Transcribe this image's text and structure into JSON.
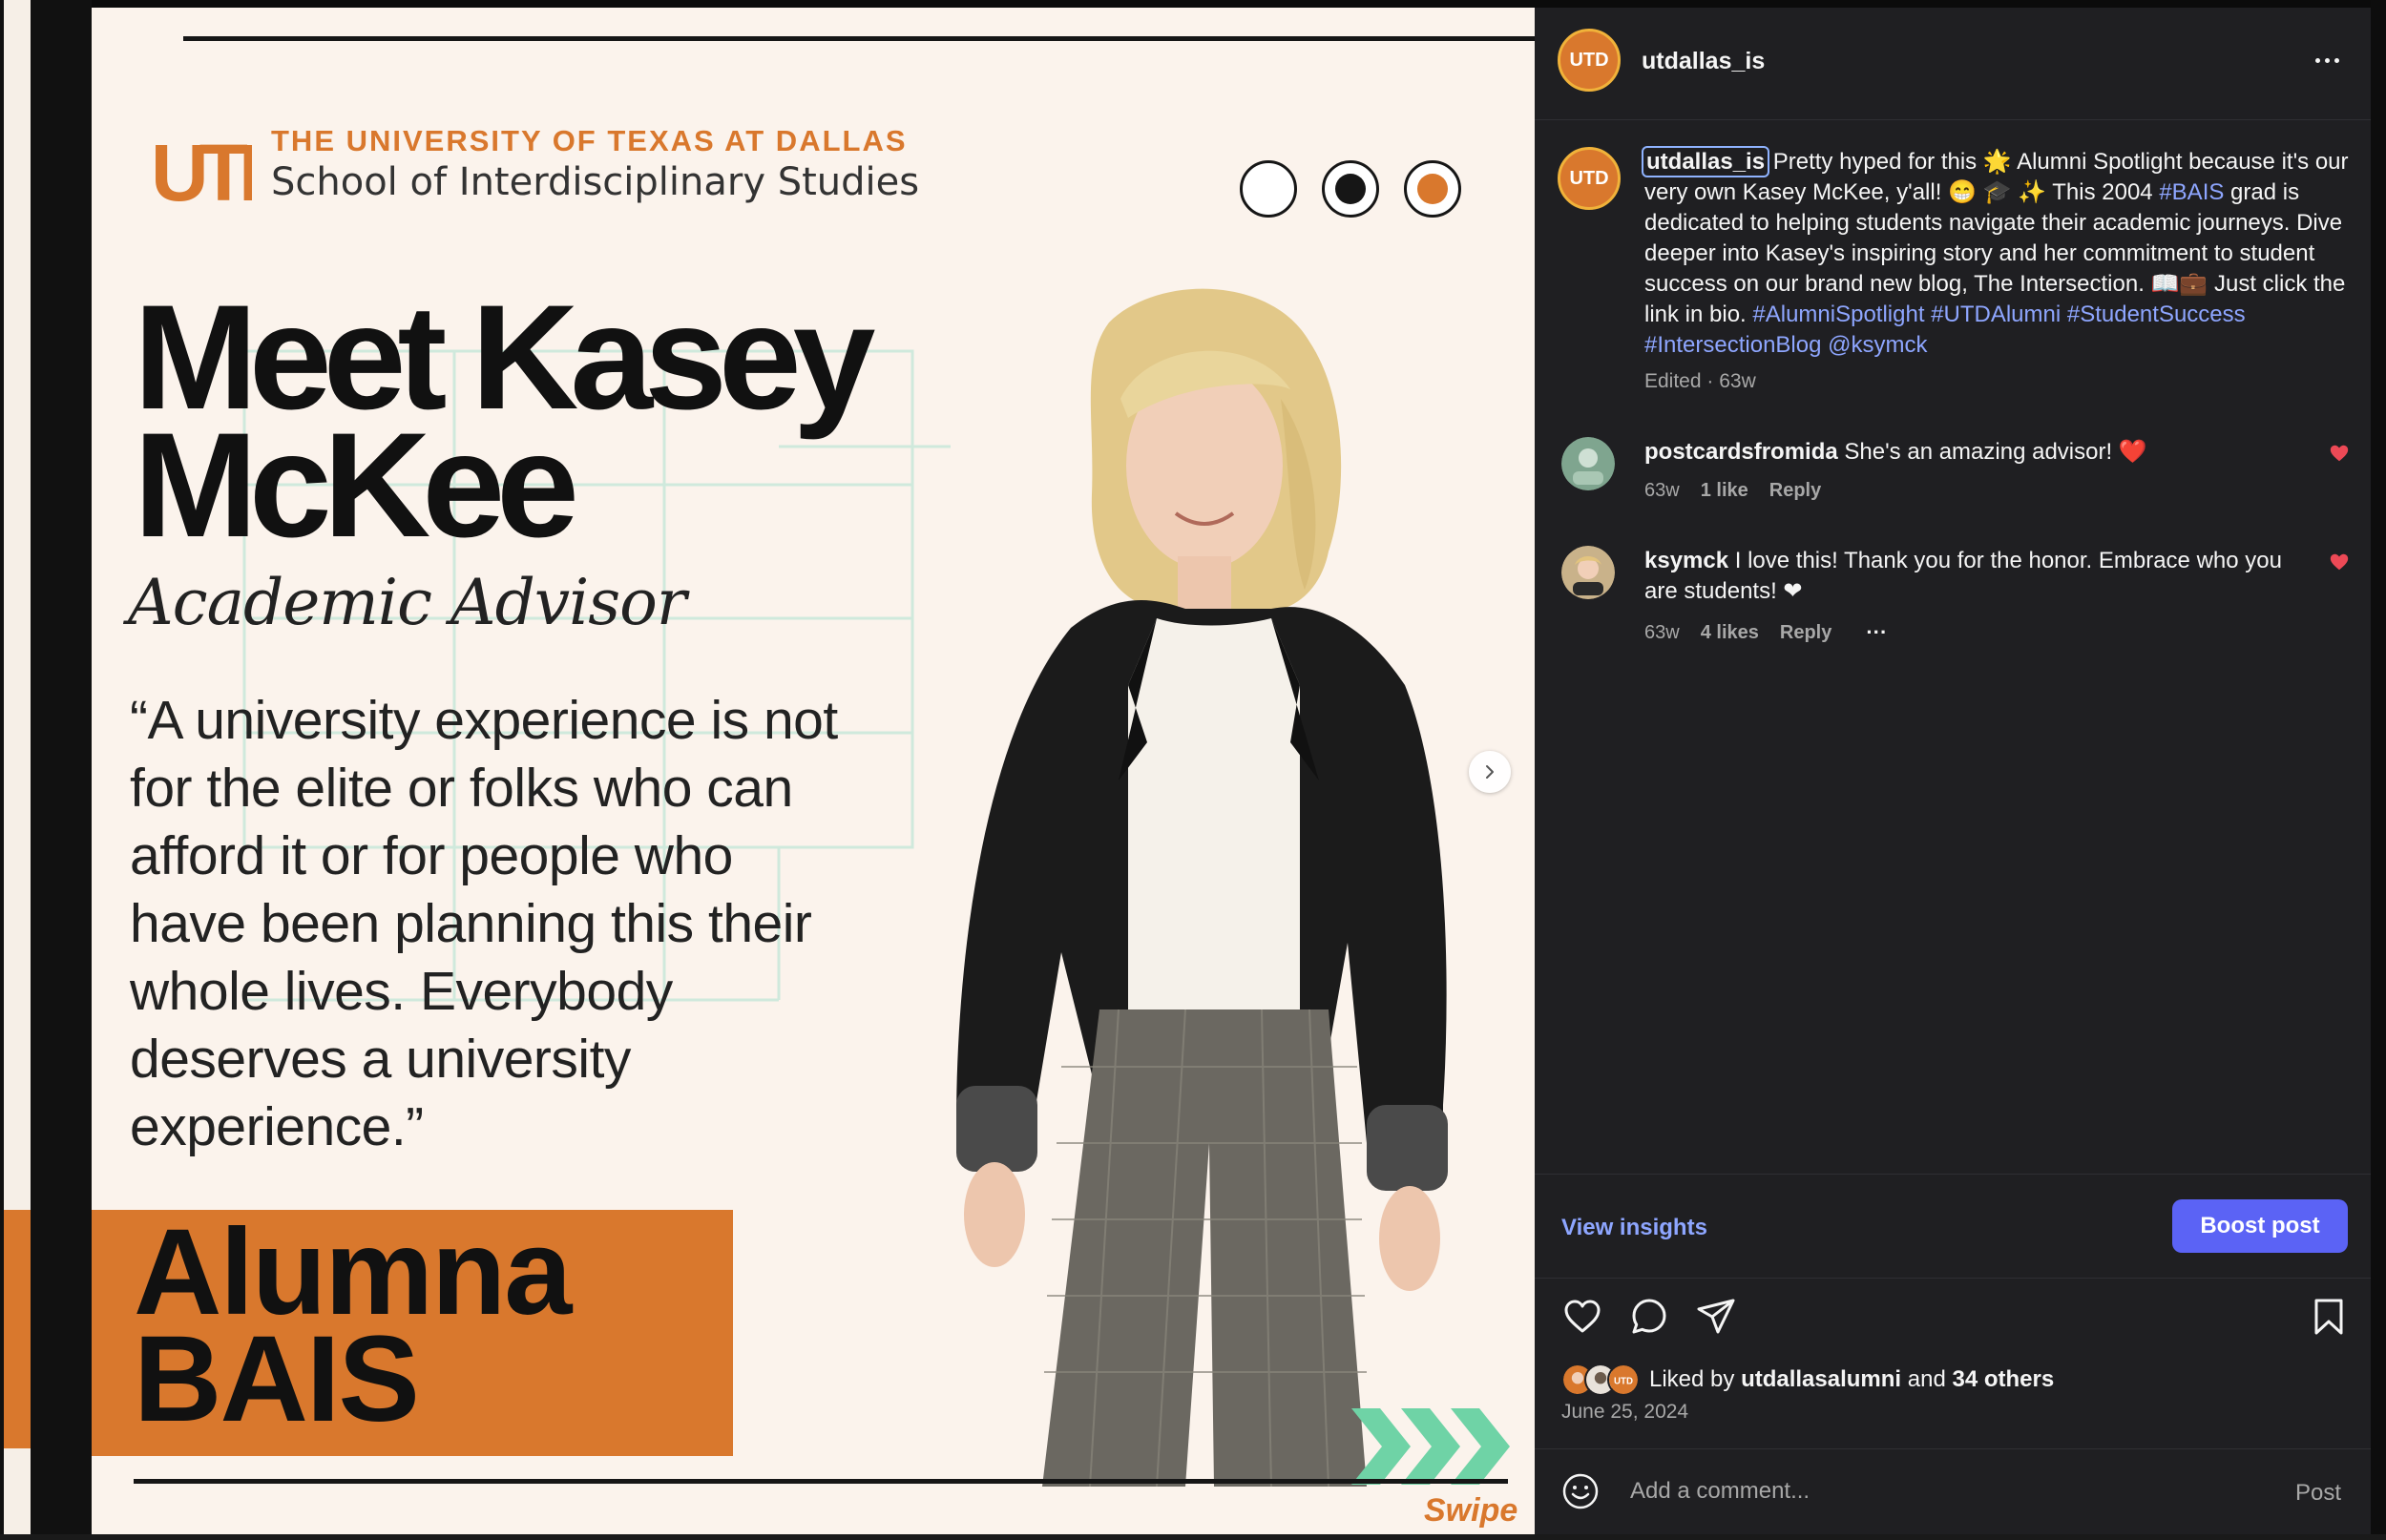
{
  "post_image": {
    "university": "THE UNIVERSITY OF TEXAS AT DALLAS",
    "school": "School of Interdisciplinary Studies",
    "logo_text": "UTD",
    "headline_line1": "Meet Kasey",
    "headline_line2": "McKee",
    "role": "Academic Advisor",
    "quote": "“A university experience is not for the elite or folks who can afford it or for people who have been planning this their whole lives. Everybody deserves a university experience.”",
    "badge_line1": "Alumna",
    "badge_line2": "BAIS",
    "swipe": "Swipe",
    "dot_colors": [
      "#ffffff",
      "#161616",
      "#d9782d"
    ],
    "accent_color": "#d9782d",
    "grid_color": "#cfe9dc",
    "arrow_color": "#6fd3a6"
  },
  "header": {
    "username": "utdallas_is",
    "avatar_text": "UTD"
  },
  "caption": {
    "username": "utdallas_is",
    "text_part1": "Pretty hyped for this 🌟 Alumni Spotlight because it's our very own Kasey McKee, y'all! 😁 🎓 ✨ This 2004 ",
    "tag_bais": "#BAIS",
    "text_part2": " grad is dedicated to helping students navigate their academic journeys. Dive deeper into Kasey's inspiring story and her commitment to student success on our brand new blog, The Intersection. 📖💼 Just click the link in bio. ",
    "tags": "#AlumniSpotlight #UTDAlumni #StudentSuccess #IntersectionBlog @ksymck",
    "meta": "Edited · 63w"
  },
  "comments": [
    {
      "username": "postcardsfromida",
      "text": "She's an amazing advisor! ❤️",
      "age": "63w",
      "likes": "1 like",
      "reply": "Reply"
    },
    {
      "username": "ksymck",
      "text": "I love this! Thank you for the honor. Embrace who you are students! ❤",
      "age": "63w",
      "likes": "4 likes",
      "reply": "Reply",
      "more": "···"
    }
  ],
  "insights": {
    "view_insights": "View insights",
    "boost": "Boost post",
    "boost_color": "#5b63f5"
  },
  "likes": {
    "prefix": "Liked by",
    "user": "utdallasalumni",
    "and": "and",
    "others": "34 others"
  },
  "date": "June 25, 2024",
  "comment_box": {
    "placeholder": "Add a comment...",
    "post": "Post"
  },
  "icons": {
    "like": "heart-icon",
    "comment": "comment-icon",
    "share": "send-icon",
    "save": "bookmark-icon",
    "emoji": "smiley-icon",
    "more": "more-horizontal-icon",
    "next": "chevron-right-icon"
  }
}
